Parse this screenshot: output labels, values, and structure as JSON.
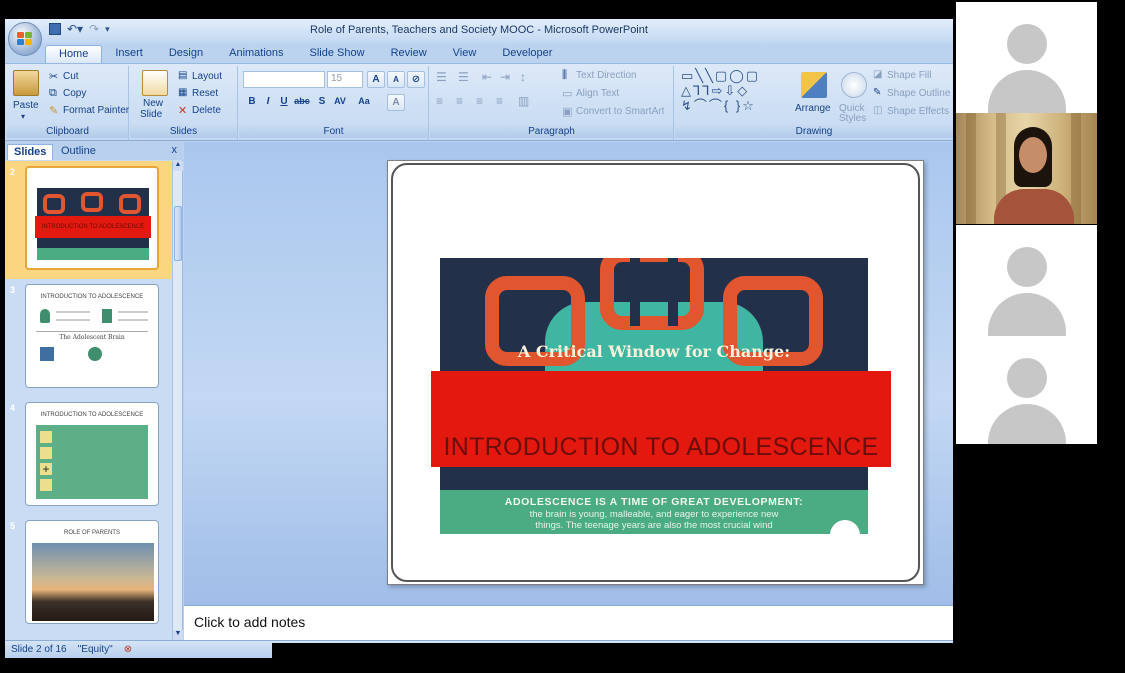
{
  "window": {
    "title": "Role of Parents, Teachers and Society MOOC - Microsoft PowerPoint"
  },
  "tabs": [
    "Home",
    "Insert",
    "Design",
    "Animations",
    "Slide Show",
    "Review",
    "View",
    "Developer"
  ],
  "ribbon": {
    "clipboard": {
      "label": "Clipboard",
      "paste": "Paste",
      "cut": "Cut",
      "copy": "Copy",
      "format_painter": "Format Painter"
    },
    "slides": {
      "label": "Slides",
      "new_slide_1": "New",
      "new_slide_2": "Slide",
      "layout": "Layout",
      "reset": "Reset",
      "delete": "Delete"
    },
    "font": {
      "label": "Font",
      "size": "15"
    },
    "paragraph": {
      "label": "Paragraph",
      "text_direction": "Text Direction",
      "align_text": "Align Text",
      "convert_smartart": "Convert to SmartArt"
    },
    "drawing": {
      "label": "Drawing",
      "arrange": "Arrange",
      "quick_styles_1": "Quick",
      "quick_styles_2": "Styles",
      "shape_fill": "Shape Fill",
      "shape_outline": "Shape Outline",
      "shape_effects": "Shape Effects"
    }
  },
  "panel": {
    "tab_slides": "Slides",
    "tab_outline": "Outline",
    "close": "x",
    "thumbnails": [
      {
        "num": "2",
        "title": "INTRODUCTION TO ADOLESCENCE",
        "selected": true
      },
      {
        "num": "3",
        "title": "INTRODUCTION TO ADOLESCENCE",
        "sub": "The Adolescent Brain"
      },
      {
        "num": "4",
        "title": "INTRODUCTION TO ADOLESCENCE"
      },
      {
        "num": "5",
        "title": "ROLE OF PARENTS"
      }
    ]
  },
  "slide": {
    "critical_window": "A Critical Window for Change:",
    "title": "INTRODUCTION TO ADOLESCENCE",
    "adolescence_heading": "ADOLESCENCE IS A TIME OF GREAT DEVELOPMENT:",
    "adolescence_sub_1": "the brain is young, malleable, and eager to experience new",
    "adolescence_sub_2": "things. The teenage years are also the most crucial wind"
  },
  "notes": {
    "placeholder": "Click to add notes"
  },
  "status": {
    "slide_info": "Slide 2 of 16",
    "theme": "\"Equity\""
  },
  "colors": {
    "ribbon": "#c4d9f1",
    "slide_red": "#e3180f",
    "chain_orange": "#e1552f",
    "teal": "#3fb6a2",
    "green": "#4bab83"
  }
}
